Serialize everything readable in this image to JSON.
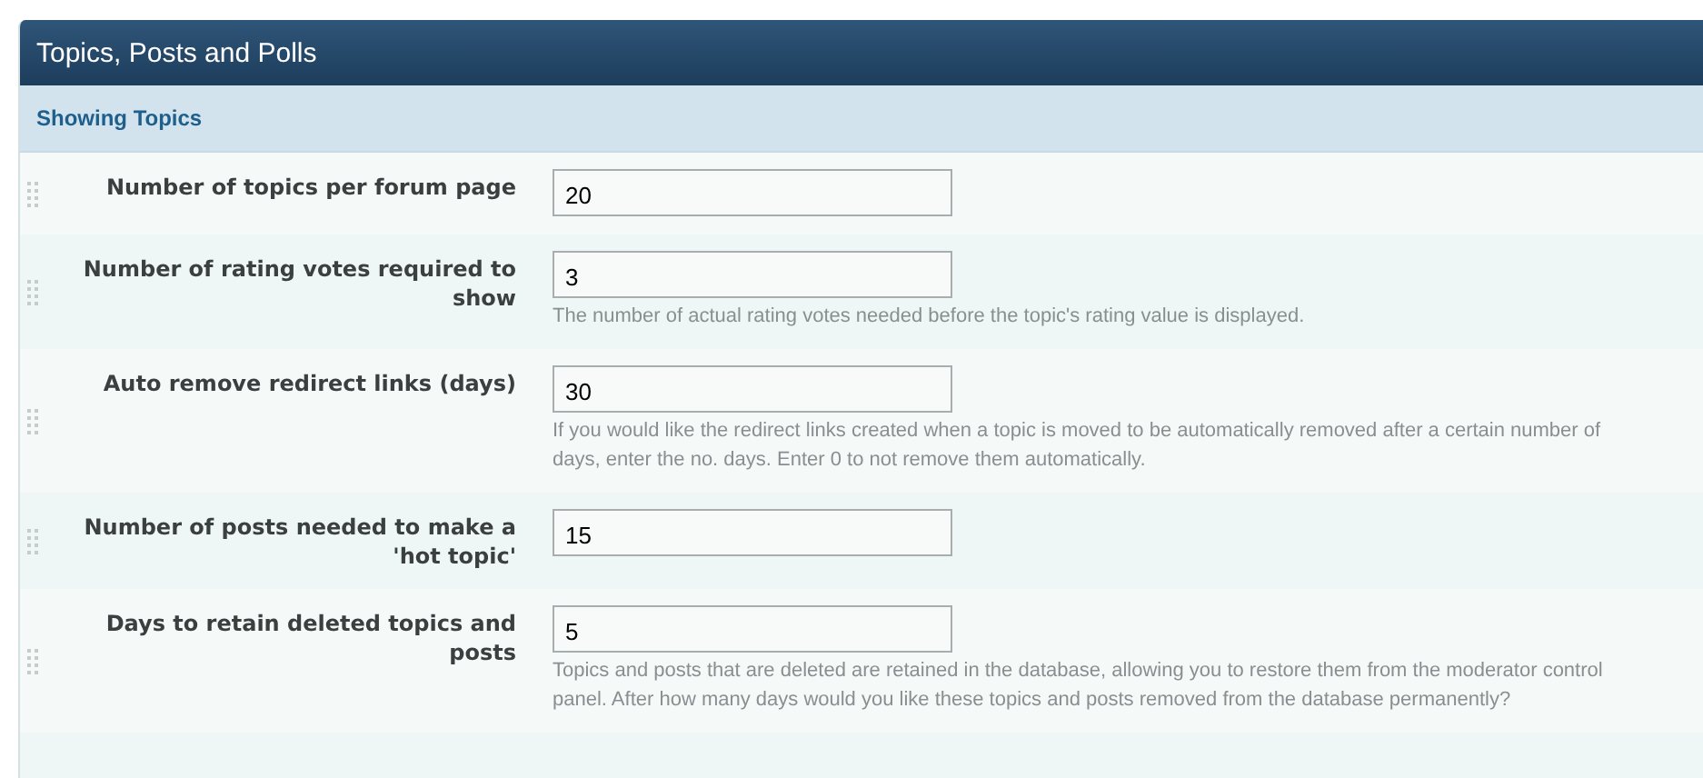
{
  "panel": {
    "title": "Topics, Posts and Polls"
  },
  "section": {
    "title": "Showing Topics"
  },
  "settings": [
    {
      "label": "Number of topics per forum page",
      "value": "20"
    },
    {
      "label": "Number of rating votes required to show",
      "value": "3",
      "description": "The number of actual rating votes needed before the topic's rating value is displayed."
    },
    {
      "label": "Auto remove redirect links (days)",
      "value": "30",
      "description": "If you would like the redirect links created when a topic is moved to be automatically removed after a certain number of days, enter the no. days. Enter 0 to not remove them automatically."
    },
    {
      "label": "Number of posts needed to make a 'hot topic'",
      "value": "15"
    },
    {
      "label": "Days to retain deleted topics and posts",
      "value": "5",
      "description": "Topics and posts that are deleted are retained in the database, allowing you to restore them from the moderator control panel. After how many days would you like these topics and posts removed from the database permanently?"
    }
  ]
}
